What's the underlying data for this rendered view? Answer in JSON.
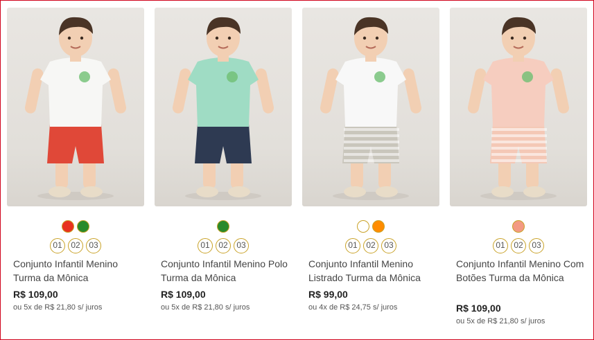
{
  "products": [
    {
      "name": "Conjunto Infantil Menino Turma da Mônica",
      "price": "R$ 109,00",
      "installments": "ou 5x de R$ 21,80 s/ juros",
      "colors": [
        "#e8321e",
        "#2a8a2a"
      ],
      "sizes": [
        "01",
        "02",
        "03"
      ]
    },
    {
      "name": "Conjunto Infantil Menino Polo Turma da Mônica",
      "price": "R$ 109,00",
      "installments": "ou 5x de R$ 21,80 s/ juros",
      "colors": [
        "#2a8a2a"
      ],
      "sizes": [
        "01",
        "02",
        "03"
      ]
    },
    {
      "name": "Conjunto Infantil Menino Listrado Turma da Mônica",
      "price": "R$ 99,00",
      "installments": "ou 4x de R$ 24,75 s/ juros",
      "colors": [
        "#ffffff",
        "#ff8c00"
      ],
      "sizes": [
        "01",
        "02",
        "03"
      ]
    },
    {
      "name": "Conjunto Infantil Menino Com Botões Turma da Mônica",
      "price": "R$ 109,00",
      "installments": "ou 5x de R$ 21,80 s/ juros",
      "colors": [
        "#f39a83"
      ],
      "sizes": [
        "01",
        "02",
        "03"
      ]
    }
  ],
  "outfits": [
    {
      "shirt": "#f7f7f5",
      "shorts": "#e04838",
      "stripes": false
    },
    {
      "shirt": "#9fdcc4",
      "shorts": "#2e3a52",
      "stripes": false
    },
    {
      "shirt": "#f8f8f8",
      "shorts": "#c9c6bc",
      "stripes": true
    },
    {
      "shirt": "#f6cdbf",
      "shorts": "#f4c8b6",
      "stripes": true
    }
  ]
}
